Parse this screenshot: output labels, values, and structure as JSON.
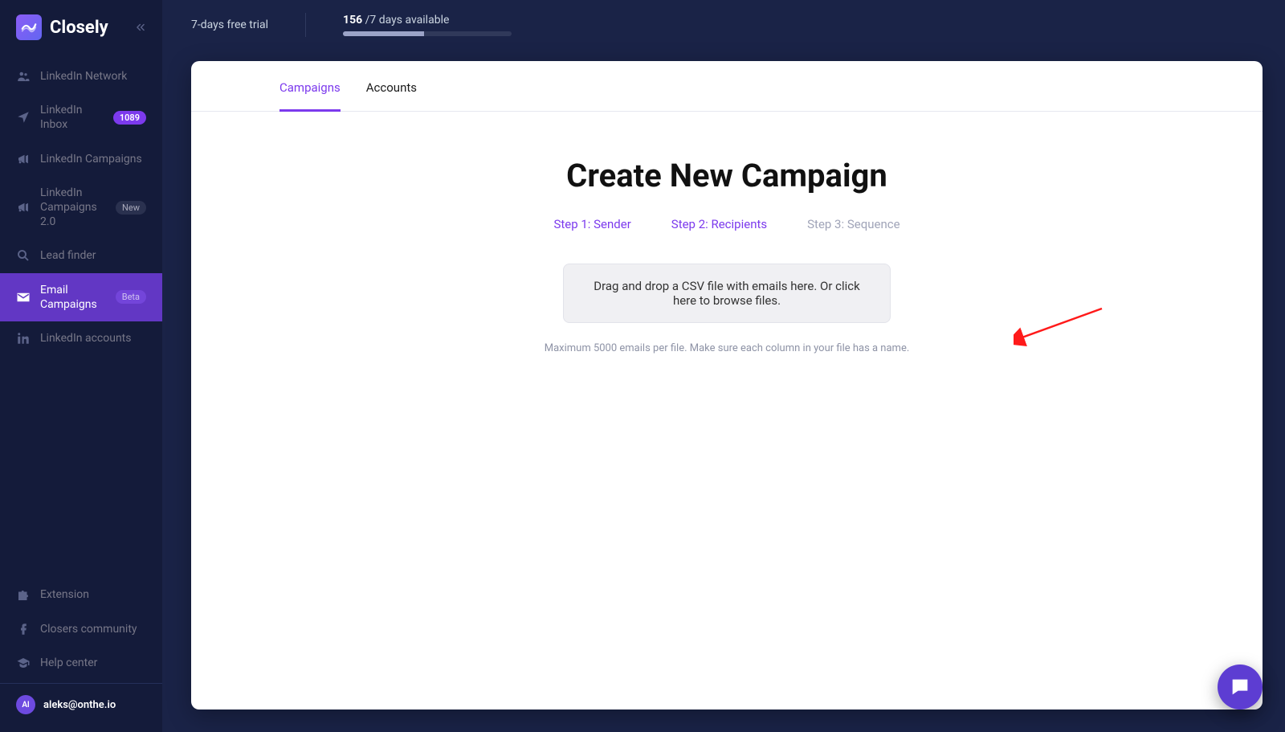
{
  "brand": "Closely",
  "sidebar": {
    "items": [
      {
        "label": "LinkedIn Network",
        "icon": "users"
      },
      {
        "label": "LinkedIn Inbox",
        "icon": "send",
        "badge": "1089",
        "badge_type": "purple"
      },
      {
        "label": "LinkedIn Campaigns",
        "icon": "megaphone"
      },
      {
        "label": "LinkedIn Campaigns 2.0",
        "icon": "megaphone",
        "badge": "New",
        "badge_type": "dark"
      },
      {
        "label": "Lead finder",
        "icon": "search"
      },
      {
        "label": "Email Campaigns",
        "icon": "mail",
        "badge": "Beta",
        "badge_type": "beta",
        "active": true
      },
      {
        "label": "LinkedIn accounts",
        "icon": "linkedin"
      }
    ],
    "footer": [
      {
        "label": "Extension",
        "icon": "puzzle"
      },
      {
        "label": "Closers community",
        "icon": "facebook"
      },
      {
        "label": "Help center",
        "icon": "graduation"
      }
    ],
    "user": {
      "initials": "Al",
      "email": "aleks@onthe.io"
    }
  },
  "topbar": {
    "trial_text": "7-days free trial",
    "count": "156",
    "suffix": "/7 days available",
    "progress_pct": 48
  },
  "tabs": {
    "campaigns": "Campaigns",
    "accounts": "Accounts"
  },
  "page": {
    "title": "Create New Campaign",
    "steps": [
      {
        "label": "Step 1: Sender",
        "active": true
      },
      {
        "label": "Step 2: Recipients",
        "active": true
      },
      {
        "label": "Step 3: Sequence",
        "active": false
      }
    ],
    "dropzone": "Drag and drop a CSV file with emails here. Or click here to browse files.",
    "hint": "Maximum 5000 emails per file. Make sure each column in your file has a name."
  }
}
